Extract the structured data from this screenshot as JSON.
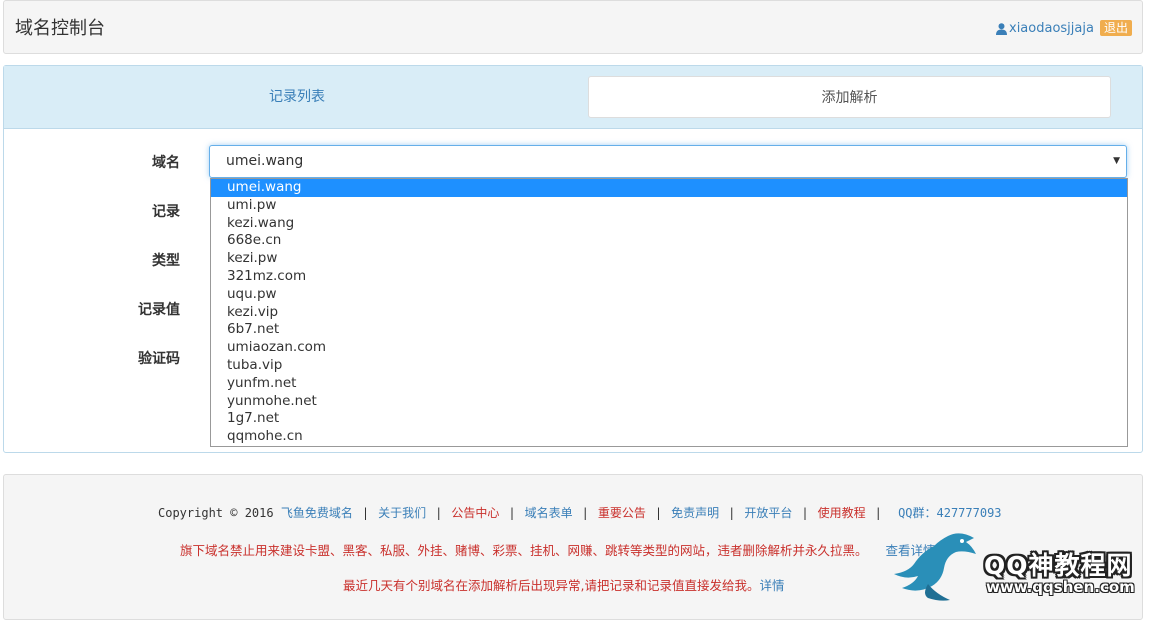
{
  "header": {
    "title": "域名控制台",
    "username": "xiaodaosjjaja",
    "logout_label": "退出"
  },
  "tabs": {
    "list_label": "记录列表",
    "add_label": "添加解析"
  },
  "form": {
    "domain_label": "域名",
    "record_label": "记录",
    "type_label": "类型",
    "value_label": "记录值",
    "captcha_label": "验证码",
    "domain_selected": "umei.wang",
    "domain_options": [
      "umei.wang",
      "umi.pw",
      "kezi.wang",
      "668e.cn",
      "kezi.pw",
      "321mz.com",
      "uqu.pw",
      "kezi.vip",
      "6b7.net",
      "umiaozan.com",
      "tuba.vip",
      "yunfm.net",
      "yunmohe.net",
      "1g7.net",
      "qqmohe.cn"
    ]
  },
  "footer": {
    "copyright": "Copyright © 2016",
    "links": [
      {
        "label": "飞鱼免费域名",
        "style": "blue"
      },
      {
        "label": "关于我们",
        "style": "blue"
      },
      {
        "label": "公告中心",
        "style": "red"
      },
      {
        "label": "域名表单",
        "style": "blue"
      },
      {
        "label": "重要公告",
        "style": "red"
      },
      {
        "label": "免责声明",
        "style": "blue"
      },
      {
        "label": "开放平台",
        "style": "blue"
      },
      {
        "label": "使用教程",
        "style": "red"
      }
    ],
    "qq_label": "QQ群：427777093",
    "notice1": "旗下域名禁止用来建设卡盟、黑客、私服、外挂、赌博、彩票、挂机、网赚、跳转等类型的网站，违者删除解析并永久拉黑。",
    "notice1_tail": "查看详情",
    "notice2": "最近几天有个别域名在添加解析后出现异常,请把记录和记录值直接发给我。",
    "notice2_link": "详情"
  },
  "watermark": {
    "text": "QQ神教程网",
    "url": "www.qqshen.com"
  },
  "colors": {
    "link_blue": "#3a7fb8",
    "alert_red": "#c9302c",
    "logout_orange": "#f0ad4e",
    "tab_bar_bg": "#d9edf7",
    "selected_option": "#1e90ff"
  }
}
